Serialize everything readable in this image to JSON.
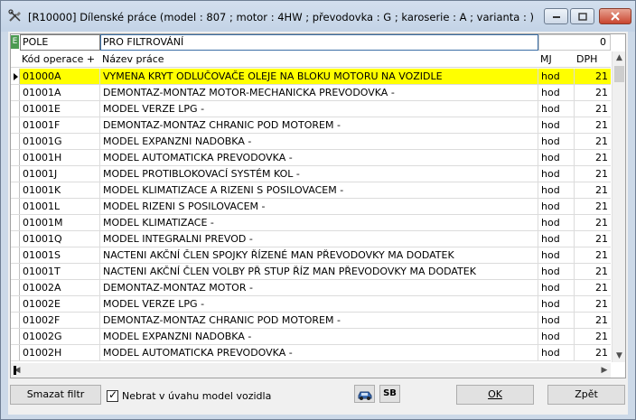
{
  "window": {
    "title": "[R10000] Dílenské práce (model : 807 ; motor : 4HW ; převodovka : G ; karoserie : A ; varianta : )"
  },
  "filter": {
    "field_label": "POLE",
    "value": "PRO FILTROVÁNÍ",
    "count": "0"
  },
  "columns": {
    "code": "Kód operace +",
    "name": "Název práce",
    "unit": "MJ",
    "vat": "DPH"
  },
  "rows": [
    {
      "code": "01000A",
      "name": "VYMENA KRYT ODLUČOVAČE OLEJE NA BLOKU MOTORU NA VOZIDLE",
      "unit": "hod",
      "vat": "21"
    },
    {
      "code": "01001A",
      "name": "DEMONTAZ-MONTAZ MOTOR-MECHANICKA PREVODOVKA -",
      "unit": "hod",
      "vat": "21"
    },
    {
      "code": "01001E",
      "name": "MODEL VERZE LPG -",
      "unit": "hod",
      "vat": "21"
    },
    {
      "code": "01001F",
      "name": "DEMONTAZ-MONTAZ CHRANIC POD MOTOREM -",
      "unit": "hod",
      "vat": "21"
    },
    {
      "code": "01001G",
      "name": "MODEL EXPANZNI NADOBKA -",
      "unit": "hod",
      "vat": "21"
    },
    {
      "code": "01001H",
      "name": "MODEL AUTOMATICKA PREVODOVKA -",
      "unit": "hod",
      "vat": "21"
    },
    {
      "code": "01001J",
      "name": "MODEL PROTIBLOKOVACÍ SYSTÉM KOL -",
      "unit": "hod",
      "vat": "21"
    },
    {
      "code": "01001K",
      "name": "MODEL KLIMATIZACE A RIZENI S POSILOVACEM -",
      "unit": "hod",
      "vat": "21"
    },
    {
      "code": "01001L",
      "name": "MODEL RIZENI S POSILOVACEM -",
      "unit": "hod",
      "vat": "21"
    },
    {
      "code": "01001M",
      "name": "MODEL KLIMATIZACE -",
      "unit": "hod",
      "vat": "21"
    },
    {
      "code": "01001Q",
      "name": "MODEL INTEGRALNI PREVOD -",
      "unit": "hod",
      "vat": "21"
    },
    {
      "code": "01001S",
      "name": "NACTENI AKČNÍ ČLEN SPOJKY ŘÍZENÉ MAN PŘEVODOVKY MA DODATEK",
      "unit": "hod",
      "vat": "21"
    },
    {
      "code": "01001T",
      "name": "NACTENI AKČNÍ ČLEN VOLBY PŘ STUP ŘÍZ MAN PŘEVODOVKY MA DODATEK",
      "unit": "hod",
      "vat": "21"
    },
    {
      "code": "01002A",
      "name": "DEMONTAZ-MONTAZ MOTOR -",
      "unit": "hod",
      "vat": "21"
    },
    {
      "code": "01002E",
      "name": "MODEL VERZE LPG -",
      "unit": "hod",
      "vat": "21"
    },
    {
      "code": "01002F",
      "name": "DEMONTAZ-MONTAZ CHRANIC POD MOTOREM -",
      "unit": "hod",
      "vat": "21"
    },
    {
      "code": "01002G",
      "name": "MODEL EXPANZNI NADOBKA -",
      "unit": "hod",
      "vat": "21"
    },
    {
      "code": "01002H",
      "name": "MODEL AUTOMATICKA PREVODOVKA -",
      "unit": "hod",
      "vat": "21"
    }
  ],
  "selected_row": 0,
  "footer": {
    "clear_filter": "Smazat filtr",
    "use_model_label": "Nebrat v úvahu model vozidla",
    "use_model_checked": true,
    "sb_label": "SB",
    "ok_label": "OK",
    "back_label": "Zpět"
  },
  "icons": {
    "app": "tools-icon",
    "car": "car-icon"
  },
  "colors": {
    "selected_row": "#ffff00",
    "filter_indicator": "#4c9a52"
  }
}
